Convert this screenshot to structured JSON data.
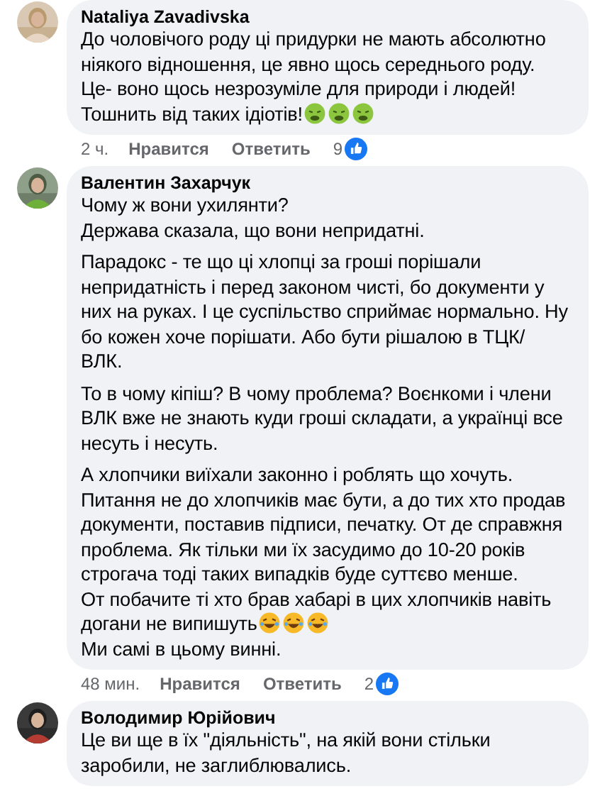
{
  "comments": [
    {
      "author": "Nataliya Zavadivska",
      "paragraphs": [
        [
          {
            "text": "До чоловічого роду ці придурки не мають абсолютно\nніякого відношення, це явно щось середнього роду."
          },
          {
            "text": "Це- воно щось незрозуміле для природи і людей!"
          },
          {
            "text": "Тошнить від таких ідіотів!",
            "emojis": [
              {
                "kind": "nauseated"
              },
              {
                "kind": "nauseated"
              },
              {
                "kind": "nauseated"
              }
            ]
          }
        ]
      ],
      "time": "2 ч.",
      "like": "Нравится",
      "reply": "Ответить",
      "likes": "9"
    },
    {
      "author": "Валентин Захарчук",
      "paragraphs": [
        [
          {
            "text": "Чому ж вони ухилянти?"
          },
          {
            "text": "Держава сказала, що вони непридатні."
          }
        ],
        [
          {
            "text": "Парадокс - те що ці хлопці за гроші порішали\nнепридатність і перед законом чисті, бо документи у\nних на руках. І це суспільство сприймає нормально. Ну\nбо кожен хоче порішати. Або бути рішалою в ТЦК/\nВЛК."
          }
        ],
        [
          {
            "text": "То в чому кіпіш? В чому проблема? Воєнкоми і члени\nВЛК вже не знають куди гроші складати, а українці все\nнесуть і несуть."
          }
        ],
        [
          {
            "text": "А хлопчики виїхали законно і роблять що хочуть."
          },
          {
            "text": "Питання не до хлопчиків має бути, а до тих хто продав\nдокументи, поставив підписи, печатку. От де справжня\nпроблема. Як тільки ми їх засудимо до 10-20 років\nстрогача тоді таких випадків буде суттєво менше."
          },
          {
            "text": "От побачите ті хто брав хабарі в цих хлопчиків навіть"
          },
          {
            "text": "догани не випишуть",
            "emojis": [
              {
                "kind": "laughing"
              },
              {
                "kind": "laughing"
              },
              {
                "kind": "laughing"
              }
            ]
          },
          {
            "text": "Ми самі в цьому винні."
          }
        ]
      ],
      "time": "48 мин.",
      "like": "Нравится",
      "reply": "Ответить",
      "likes": "2"
    },
    {
      "author": "Володимир Юрійович",
      "paragraphs": [
        [
          {
            "text": "Це ви ще в їх \"діяльність\", на якій вони стільки\nзаробили, не заглиблювались."
          }
        ]
      ]
    }
  ]
}
